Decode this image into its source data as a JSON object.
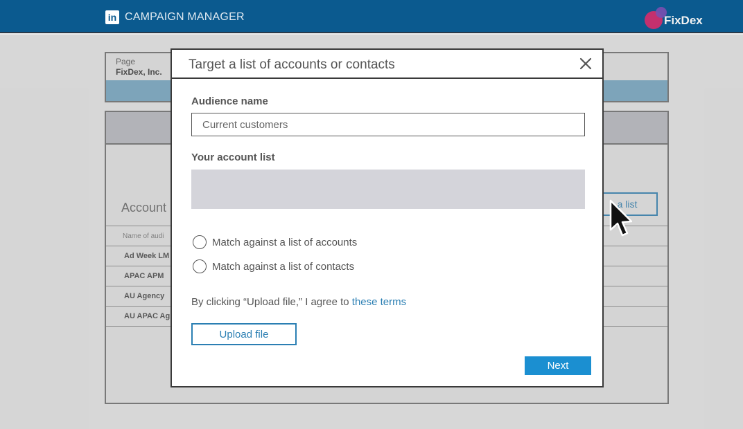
{
  "header": {
    "logo_text": "in",
    "app_title": "CAMPAIGN MANAGER",
    "brand_name": "FixDex",
    "brand_colors": {
      "bar": "#0b5a8f",
      "logo_pink": "#c3306e",
      "logo_purple": "#7a4fb0"
    }
  },
  "background_page": {
    "page_label": "Page",
    "page_value": "FixDex, Inc.",
    "accounts_title": "Account",
    "list_button_label": "a list",
    "table_header_name": "Name of audi",
    "rows": [
      "Ad Week LM",
      "APAC APM",
      "AU Agency",
      "AU APAC Ag"
    ]
  },
  "modal": {
    "title": "Target a list of accounts or contacts",
    "audience_name_label": "Audience name",
    "audience_name_value": "Current customers",
    "account_list_label": "Your account list",
    "radio_options": [
      {
        "label": "Match against a list of accounts",
        "selected": false
      },
      {
        "label": "Match against a list of contacts",
        "selected": false
      }
    ],
    "terms_text": "By clicking “Upload file,” I agree to ",
    "terms_link": "these terms",
    "upload_button": "Upload file",
    "next_button": "Next",
    "accent_color": "#2b7fb3",
    "primary_button_color": "#1b8fd1"
  },
  "icons": {
    "close": "close-icon",
    "cursor": "mouse-pointer-icon"
  }
}
